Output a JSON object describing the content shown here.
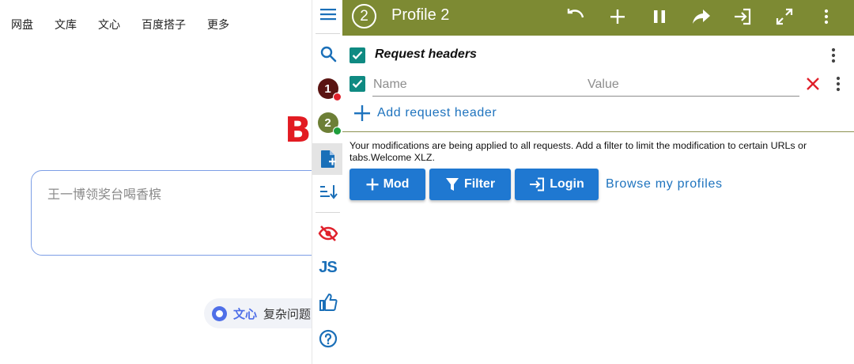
{
  "background_page": {
    "nav": [
      "网盘",
      "文库",
      "文心",
      "百度搭子",
      "更多"
    ],
    "logo_fragment": "B",
    "search_placeholder": "王一博领奖台喝香槟",
    "chip": {
      "brand": "文心",
      "text": "复杂问题"
    }
  },
  "sidebar": {
    "profiles": [
      {
        "number": "1",
        "color": "#5a1412",
        "status_color": "#e0202b"
      },
      {
        "number": "2",
        "color": "#6d7f36",
        "status_color": "#1e9e3c"
      }
    ],
    "js_label": "JS"
  },
  "topbar": {
    "badge": "2",
    "title": "Profile 2",
    "color": "#7d8a33"
  },
  "request_headers": {
    "title": "Request headers",
    "name_placeholder": "Name",
    "value_placeholder": "Value",
    "add_label": "Add request header"
  },
  "info_text": "Your modifications are being applied to all requests. Add a filter to limit the modification to certain URLs or tabs.Welcome XLZ.",
  "actions": {
    "mod_label": "Mod",
    "filter_label": "Filter",
    "login_label": "Login",
    "browse_label": "Browse my profiles"
  },
  "colors": {
    "accent_blue": "#1f78d1",
    "teal_check": "#0f8a82",
    "delete_red": "#e0202b"
  }
}
